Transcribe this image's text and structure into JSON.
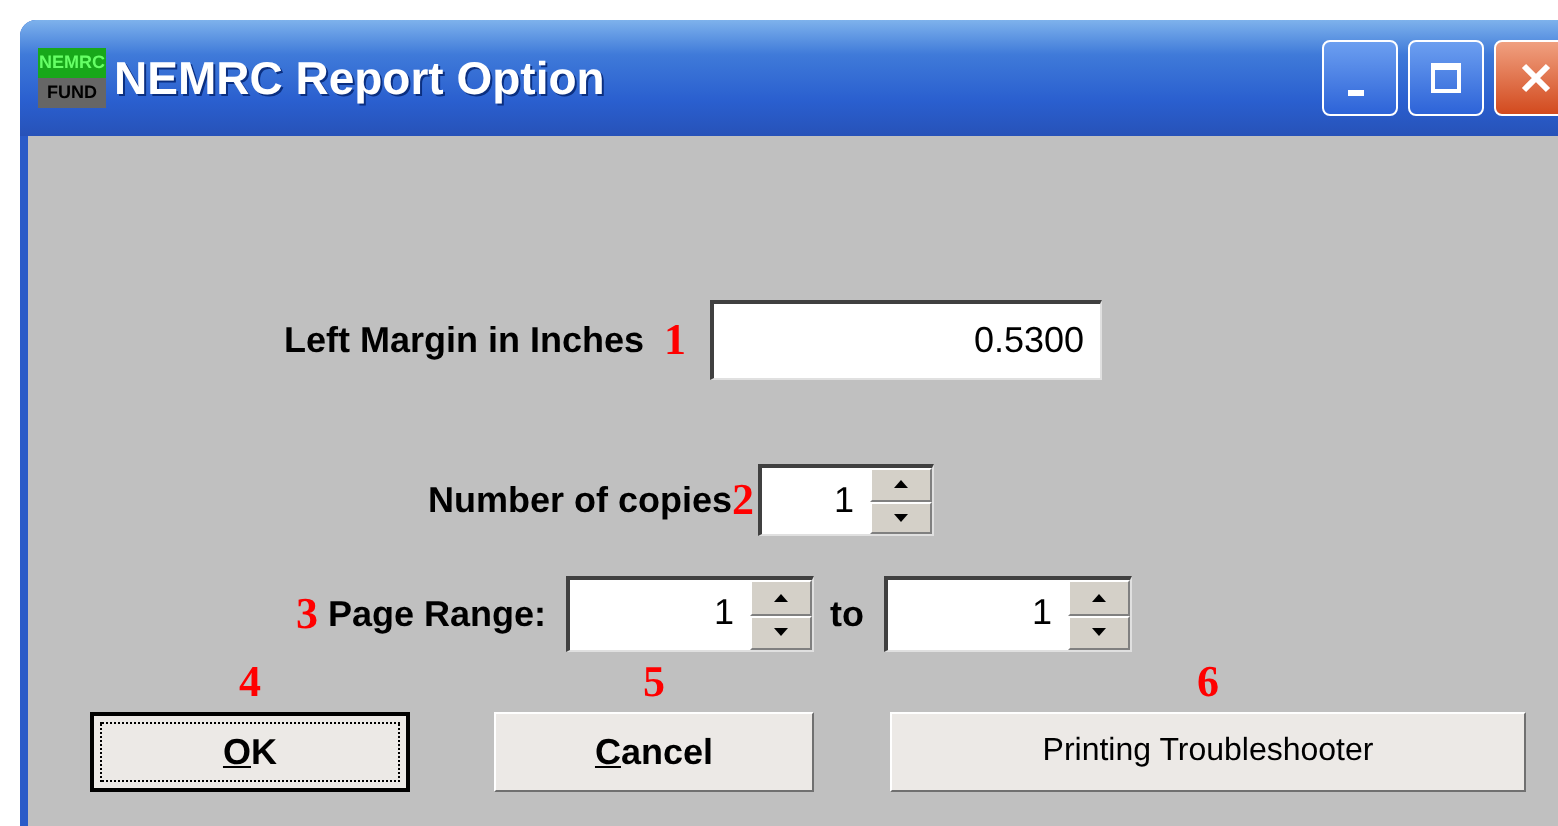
{
  "window": {
    "title": "NEMRC Report Option",
    "icon_text_top": "NEMRC",
    "icon_text_bottom": "FUND"
  },
  "left_margin": {
    "label": "Left Margin in Inches",
    "callout": "1",
    "value": "0.5300"
  },
  "copies": {
    "label": "Number of copies",
    "callout": "2",
    "value": "1"
  },
  "page_range": {
    "callout": "3",
    "label": "Page Range:",
    "from": "1",
    "separator": "to",
    "to": "1"
  },
  "buttons": [
    {
      "callout": "4",
      "mnemonic": "O",
      "rest": "K",
      "default": true
    },
    {
      "callout": "5",
      "mnemonic": "C",
      "rest": "ancel",
      "default": false
    },
    {
      "callout": "6",
      "rest": "Printing Troubleshooter",
      "default": false
    }
  ]
}
